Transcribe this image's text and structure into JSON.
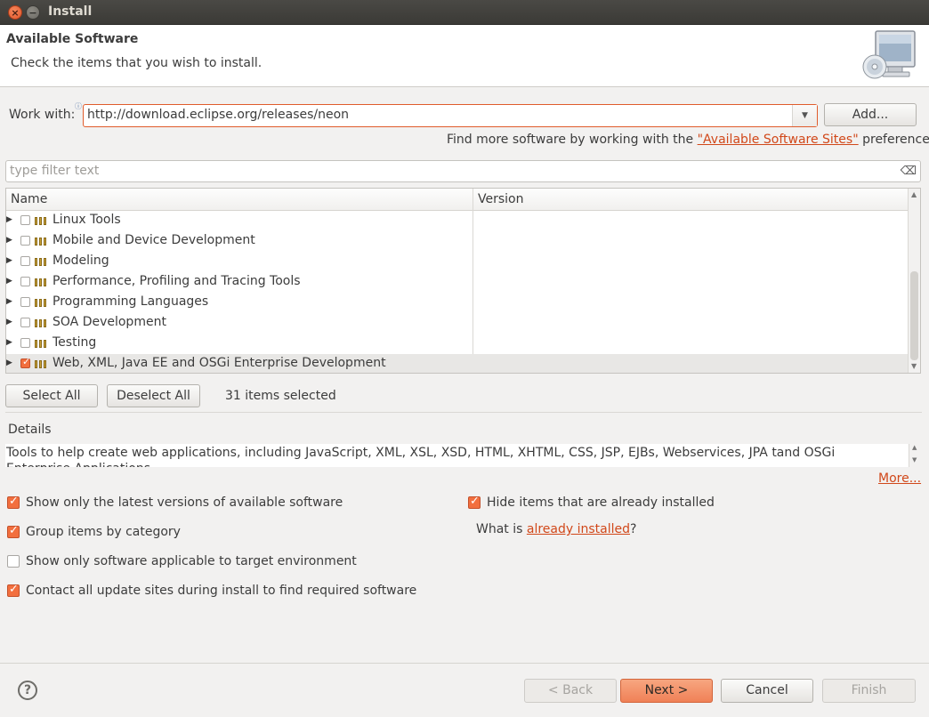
{
  "window": {
    "title": "Install"
  },
  "header": {
    "title": "Available Software",
    "message": "Check the items that you wish to install."
  },
  "work_with": {
    "label": "Work with:",
    "value": "http://download.eclipse.org/releases/neon",
    "add_label": "Add...",
    "find_more_prefix": "Find more software by working with the ",
    "find_more_link": "\"Available Software Sites\"",
    "find_more_suffix": " preferences."
  },
  "filter": {
    "placeholder": "type filter text"
  },
  "table": {
    "columns": [
      "Name",
      "Version"
    ],
    "rows": [
      {
        "label": "Linux Tools",
        "checked": false
      },
      {
        "label": "Mobile and Device Development",
        "checked": false
      },
      {
        "label": "Modeling",
        "checked": false
      },
      {
        "label": "Performance, Profiling and Tracing Tools",
        "checked": false
      },
      {
        "label": "Programming Languages",
        "checked": false
      },
      {
        "label": "SOA Development",
        "checked": false
      },
      {
        "label": "Testing",
        "checked": false
      },
      {
        "label": "Web, XML, Java EE and OSGi Enterprise Development",
        "checked": true
      }
    ]
  },
  "selection": {
    "select_all_label": "Select All",
    "deselect_all_label": "Deselect All",
    "count_text": "31 items selected"
  },
  "details": {
    "label": "Details",
    "text": "Tools to help create web applications, including JavaScript, XML, XSL, XSD, HTML, XHTML, CSS, JSP, EJBs, Webservices, JPA tand OSGi Enterprise Applications.",
    "more_label": "More..."
  },
  "options": {
    "latest_versions": {
      "label": "Show only the latest versions of available software",
      "checked": true
    },
    "group_by_category": {
      "label": "Group items by category",
      "checked": true
    },
    "target_env": {
      "label": "Show only software applicable to target environment",
      "checked": false
    },
    "contact_sites": {
      "label": "Contact all update sites during install to find required software",
      "checked": true
    },
    "hide_installed": {
      "label": "Hide items that are already installed",
      "checked": true
    },
    "what_is_prefix": "What is ",
    "what_is_link": "already installed",
    "what_is_suffix": "?"
  },
  "footer": {
    "help_glyph": "?",
    "back_label": "< Back",
    "next_label": "Next >",
    "cancel_label": "Cancel",
    "finish_label": "Finish"
  },
  "colors": {
    "accent": "#f08157",
    "link": "#d1481a",
    "title_bar": "#3b3a36"
  }
}
